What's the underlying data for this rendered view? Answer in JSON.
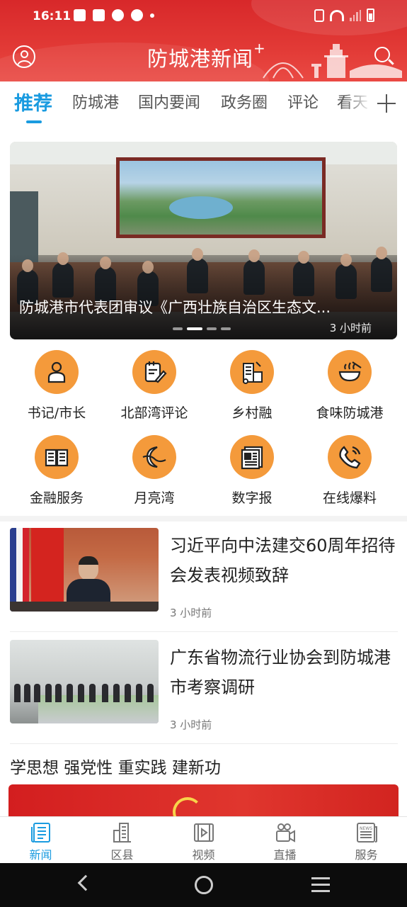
{
  "status_bar": {
    "time": "16:11"
  },
  "header": {
    "brand": "防城港新闻",
    "brand_plus": "+"
  },
  "tabs": [
    {
      "label": "推荐",
      "active": true
    },
    {
      "label": "防城港"
    },
    {
      "label": "国内要闻"
    },
    {
      "label": "政务圈"
    },
    {
      "label": "评论"
    },
    {
      "label": "看天"
    }
  ],
  "banner": {
    "title": "防城港市代表团审议《广西壮族自治区生态文...",
    "time": "3 小时前",
    "slide_index": 2,
    "slide_count": 4
  },
  "shortcuts": [
    {
      "label": "书记/市长",
      "icon": "person-icon"
    },
    {
      "label": "北部湾评论",
      "icon": "notepad-pen-icon"
    },
    {
      "label": "乡村融",
      "icon": "village-icon"
    },
    {
      "label": "食味防城港",
      "icon": "food-bowl-icon"
    },
    {
      "label": "金融服务",
      "icon": "book-icon"
    },
    {
      "label": "月亮湾",
      "icon": "moon-icon"
    },
    {
      "label": "数字报",
      "icon": "newspaper-icon"
    },
    {
      "label": "在线爆料",
      "icon": "phone-icon"
    }
  ],
  "news": [
    {
      "title": "习近平向中法建交60周年招待会发表视频致辞",
      "time": "3 小时前"
    },
    {
      "title": "广东省物流行业协会到防城港市考察调研",
      "time": "3 小时前"
    }
  ],
  "section": {
    "title": "学思想 强党性 重实践 建新功"
  },
  "bottom_nav": [
    {
      "label": "新闻",
      "icon": "news-icon",
      "active": true
    },
    {
      "label": "区县",
      "icon": "district-icon"
    },
    {
      "label": "视频",
      "icon": "video-icon"
    },
    {
      "label": "直播",
      "icon": "live-camera-icon"
    },
    {
      "label": "服务",
      "icon": "service-news-icon"
    }
  ],
  "colors": {
    "brand_red": "#d8282a",
    "accent_blue": "#1a9be0",
    "icon_orange": "#f49a3b"
  }
}
